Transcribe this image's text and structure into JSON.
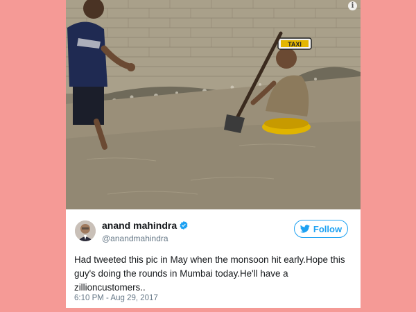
{
  "tweet": {
    "author_name": "anand mahindra",
    "handle": "@anandmahindra",
    "follow_label": "Follow",
    "text": "Had tweeted this pic in May when the monsoon hit early.Hope this guy's doing the rounds in Mumbai today.He'll have a zillioncustomers..",
    "timestamp": "6:10 PM - Aug 29, 2017"
  },
  "photo": {
    "taxi_sign": "TAXI"
  },
  "colors": {
    "page_background": "#f59a96",
    "twitter_blue": "#1da1f2"
  },
  "icons": {
    "info": "info-icon",
    "verified": "verified-badge-icon",
    "bird": "twitter-bird-icon"
  }
}
